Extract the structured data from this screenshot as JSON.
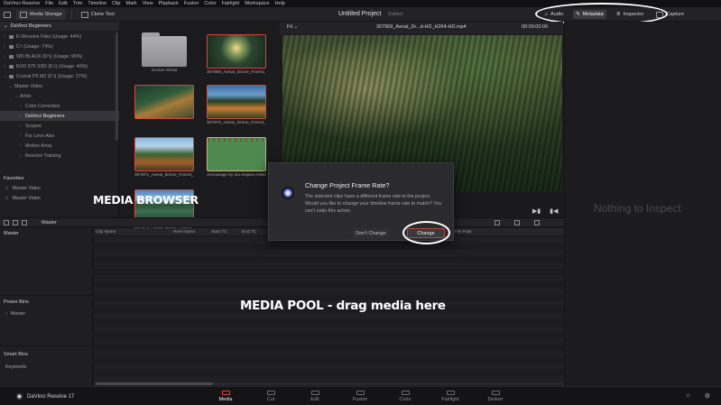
{
  "menubar": [
    "DaVinci Resolve",
    "File",
    "Edit",
    "Trim",
    "Timeline",
    "Clip",
    "Mark",
    "View",
    "Playback",
    "Fusion",
    "Color",
    "Fairlight",
    "Workspace",
    "Help"
  ],
  "toolbar": {
    "media_storage": "Media Storage",
    "clone_tool": "Clone Tool",
    "project_title": "Untitled Project",
    "project_state": "Edited",
    "audio": "Audio",
    "metadata": "Metadata",
    "inspector": "Inspector",
    "capture": "Capture"
  },
  "browser": {
    "path": "DaVinci Beginners",
    "tree": [
      {
        "label": "E:\\Resolve Files (Usage: 44%)",
        "arrow": "›",
        "disk": true
      },
      {
        "label": "C:\\ (Usage: 74%)",
        "arrow": "›",
        "disk": true
      },
      {
        "label": "WD BLACK (D:\\) (Usage: 96%)",
        "arrow": "›",
        "disk": true
      },
      {
        "label": "EVO 970 SSD (E:\\) (Usage: 43%)",
        "arrow": "›",
        "disk": true
      },
      {
        "label": "Crucial P5 M2 (F:\\) (Usage: 27%)",
        "arrow": "⌄",
        "disk": true
      },
      {
        "label": "Master Video",
        "arrow": "⌄",
        "disk": false
      },
      {
        "label": "Artist",
        "arrow": "⌄",
        "disk": false
      },
      {
        "label": "Color Correction",
        "arrow": "›",
        "disk": false
      },
      {
        "label": "DaVinci Beginners",
        "arrow": "›",
        "disk": false,
        "selected": true
      },
      {
        "label": "Scopes",
        "arrow": "›",
        "disk": false
      },
      {
        "label": "For Love Alex",
        "arrow": "›",
        "disk": false
      },
      {
        "label": "Motion Array",
        "arrow": "›",
        "disk": false
      },
      {
        "label": "Resolve Training",
        "arrow": "›",
        "disk": false
      }
    ],
    "favorites_title": "Favorites",
    "favorites": [
      "Master Video",
      "Master Video"
    ],
    "thumbs": [
      {
        "label": "Screen Shots",
        "kind": "folder"
      },
      {
        "label": "307969_Aerial_Drone_Forest_N...",
        "kind": "img-forest2"
      },
      {
        "label": "",
        "kind": "img-forest1"
      },
      {
        "label": "307972_Aerial_Drone_Forest_N...",
        "kind": "img-forest3"
      },
      {
        "label": "307971_Aerial_Drone_Forest_N...",
        "kind": "img-forest5"
      },
      {
        "label": "encourage by lux-inspira Artlist",
        "kind": "img-green"
      },
      {
        "label": "307974_Aerial_Drone_Forest_N...",
        "kind": "img-forest4"
      }
    ]
  },
  "viewer": {
    "fit": "Fit",
    "clip_name": "307969_Aerial_Dr...d-HD_H264-HD.mp4",
    "timecode": "00:00:00:00"
  },
  "inspector_panel": {
    "empty_text": "Nothing to Inspect"
  },
  "pool": {
    "bin_label": "Master",
    "columns": [
      "Clip Name",
      "Reel Name",
      "Start TC",
      "End TC",
      "File Path"
    ],
    "bins": {
      "master": "Master",
      "power_bins": "Power Bins",
      "power_master": "Master",
      "smart_bins": "Smart Bins",
      "keywords": "Keywords"
    }
  },
  "dialog": {
    "title": "Change Project Frame Rate?",
    "body": "The selected clips have a different frame rate to the project. Would you like to change your timeline frame rate to match? You can't undo this action.",
    "cancel_label": "Don't Change",
    "ok_label": "Change"
  },
  "annotations": {
    "browser": "MEDIA BROWSER",
    "pool": "MEDIA POOL - drag media here"
  },
  "pagebar": {
    "brand": "DaVinci Resolve 17",
    "tabs": [
      "Media",
      "Cut",
      "Edit",
      "Fusion",
      "Color",
      "Fairlight",
      "Deliver"
    ],
    "active_tab": "Media"
  },
  "colors": {
    "accent": "#e2423b",
    "annotation": "#ffffff"
  }
}
